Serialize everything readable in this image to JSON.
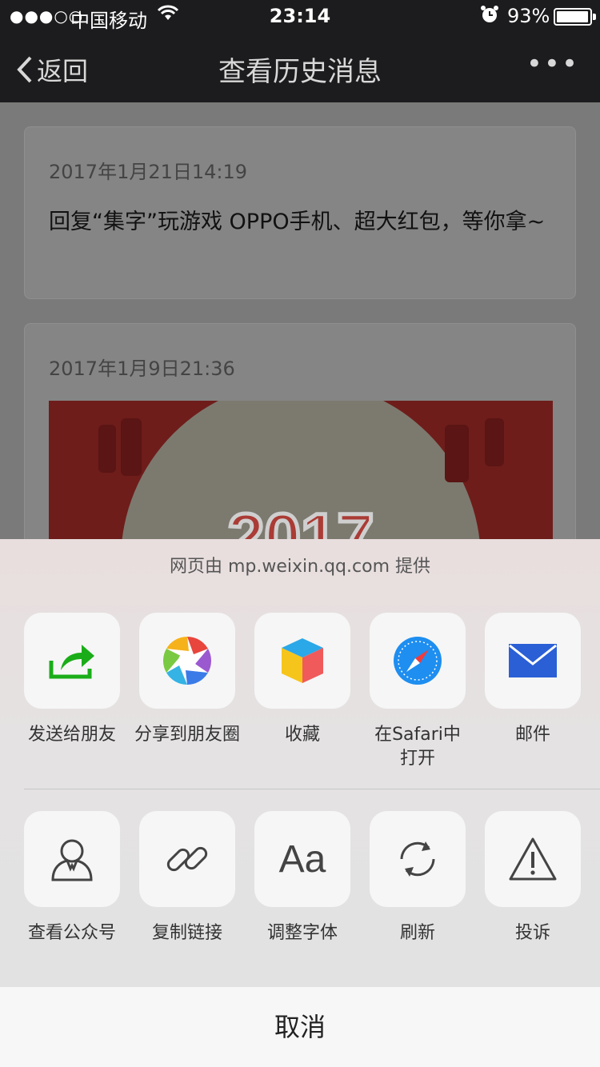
{
  "status_bar": {
    "signal": "●●●○○",
    "carrier": "中国移动",
    "time": "23:14",
    "battery_pct": "93%",
    "battery_level": 0.93
  },
  "navbar": {
    "back_label": "返回",
    "title": "查看历史消息",
    "more_label": "•••"
  },
  "messages": [
    {
      "date": "2017年1月21日14:19",
      "text": "回复“集字”玩游戏 OPPO手机、超大红包，等你拿~"
    },
    {
      "date": "2017年1月9日21:36",
      "image_text": "2017"
    }
  ],
  "share_sheet": {
    "provider": "网页由 mp.weixin.qq.com 提供",
    "row1": [
      {
        "label": "发送给朋友",
        "icon": "share-arrow-icon"
      },
      {
        "label": "分享到朋友圈",
        "icon": "moments-aperture-icon"
      },
      {
        "label": "收藏",
        "icon": "favorites-cube-icon"
      },
      {
        "label": "在Safari中打开",
        "icon": "safari-compass-icon"
      },
      {
        "label": "邮件",
        "icon": "mail-envelope-icon"
      }
    ],
    "row2": [
      {
        "label": "查看公众号",
        "icon": "official-account-icon"
      },
      {
        "label": "复制链接",
        "icon": "link-icon"
      },
      {
        "label": "调整字体",
        "icon": "font-aa-icon",
        "glyph": "Aa"
      },
      {
        "label": "刷新",
        "icon": "refresh-icon"
      },
      {
        "label": "投诉",
        "icon": "warning-icon"
      }
    ],
    "cancel_label": "取消"
  },
  "colors": {
    "bar_bg": "#1c1c1e",
    "share_green": "#1aad19",
    "mail_blue": "#2a5fd6",
    "safari_blue": "#1e8ef0"
  }
}
